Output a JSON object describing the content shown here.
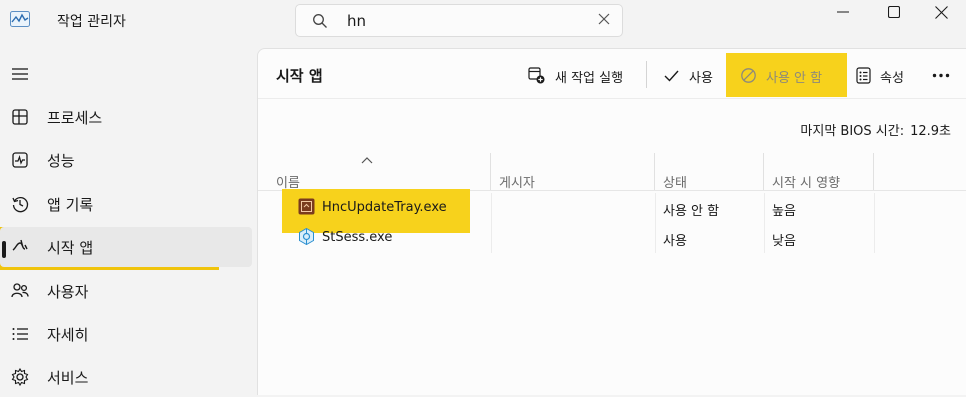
{
  "app": {
    "title": "작업 관리자"
  },
  "search": {
    "value": "hn"
  },
  "nav": [
    {
      "label": "프로세스",
      "icon": "processes-icon"
    },
    {
      "label": "성능",
      "icon": "performance-icon"
    },
    {
      "label": "앱 기록",
      "icon": "app-history-icon"
    },
    {
      "label": "시작 앱",
      "icon": "startup-apps-icon"
    },
    {
      "label": "사용자",
      "icon": "users-icon"
    },
    {
      "label": "자세히",
      "icon": "details-icon"
    },
    {
      "label": "서비스",
      "icon": "services-icon"
    }
  ],
  "page": {
    "title": "시작 앱",
    "toolbar": {
      "run_new_task": "새 작업 실행",
      "enable": "사용",
      "disable": "사용 안 함",
      "properties": "속성"
    },
    "bios_label": "마지막 BIOS 시간:",
    "bios_value": "12.9초"
  },
  "table": {
    "columns": [
      "이름",
      "게시자",
      "상태",
      "시작 시 영향"
    ],
    "rows": [
      {
        "name": "HncUpdateTray.exe",
        "publisher": "",
        "status": "사용 안 함",
        "impact": "높음"
      },
      {
        "name": "StSess.exe",
        "publisher": "",
        "status": "사용",
        "impact": "낮음"
      }
    ]
  },
  "colors": {
    "highlight": "#f7d21c",
    "nav_highlight": "#f0c40c"
  }
}
